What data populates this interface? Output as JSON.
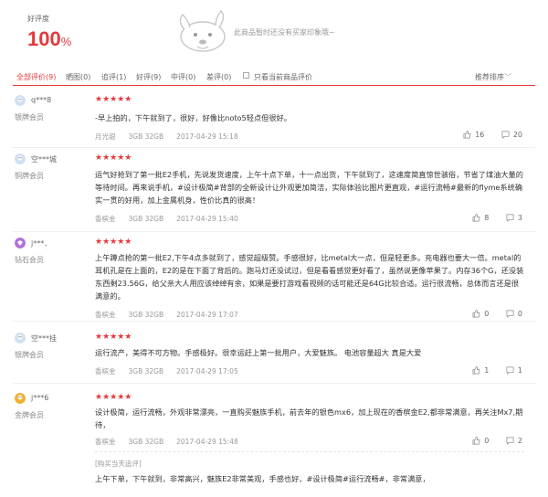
{
  "summary": {
    "rate_label": "好评度",
    "rate_number": "100",
    "rate_unit": "%",
    "no_impression": "此商品暂时还没有买家印象哦~",
    "mascot_icon": "dog-mascot-icon"
  },
  "tabs": [
    {
      "label": "全部评价(9)",
      "active": true
    },
    {
      "label": "晒图(0)"
    },
    {
      "label": "追评(1)"
    },
    {
      "label": "好评(9)"
    },
    {
      "label": "中评(0)"
    },
    {
      "label": "差评(0)"
    }
  ],
  "only_current": "只看当前商品评价",
  "sort_label": "推荐排序",
  "colors": {
    "accent": "#e4393c",
    "star": "#e4393c"
  },
  "reviews": [
    {
      "user": "q***8",
      "level": "银牌会员",
      "avatar_color": "#cfe0f2",
      "stars": "★★★★★",
      "content": "-早上拍的，下午就到了，很好，好像比noto5轻点但很好。",
      "color": "月光银",
      "spec": "3GB 32GB",
      "date": "2017-04-29 15:18",
      "likes": "16",
      "comments": "20"
    },
    {
      "user": "空***城",
      "level": "铜牌会员",
      "avatar_color": "#cfe0f2",
      "stars": "★★★★★",
      "content": "运气好抢到了第一批E2手机，先说发货速度，上午十点下单，十一点出货，下午就到了，这速度简直惊世骇俗，节省了煤油大量的等待时间。再来说手机，#设计极简#背部的全新设计让外观更加简洁，实际体验比图片更直观，#运行流畅#最新的flyme系统确实一贯的好用，加上金属机身，性价比真的很高！",
      "color": "香槟金",
      "spec": "3GB 32GB",
      "date": "2017-04-29 15:40",
      "likes": "8",
      "comments": "3"
    },
    {
      "user": "j***．",
      "level": "钻石会员",
      "avatar_color": "#b36fd8",
      "stars": "★★★★★",
      "content": "上午蹲点抢的第一批E2,下午4点多就到了，感觉超级赞。手感很好，比metal大一点，但是轻更多。充电器也要大一倍。metal的耳机孔是在上面的，E2的是在下面了背后的。跑马灯还没试过，但是看看感觉更好看了，虽然说更像苹果了。内存36个G，还没装东西剩23.56G，给父亲大人用应该绰绰有余，如果是要打游戏看视频的话可能还是64G比较合适。运行很流畅，总体而言还是很满意的。",
      "color": "香槟金",
      "spec": "3GB 32GB",
      "date": "2017-04-29 17:07",
      "likes": "0",
      "comments": "0"
    },
    {
      "user": "空***挂",
      "level": "银牌会员",
      "avatar_color": "#cfe0f2",
      "stars": "★★★★★",
      "content": "运行流产，美得不可方物。手感极好。很幸运赶上第一批用户，大爱魅族。 电池容量超大 真是大爱",
      "color": "香槟金",
      "spec": "3GB 32GB",
      "date": "2017-04-29 17:05",
      "likes": "1",
      "comments": "1"
    },
    {
      "user": "j***6",
      "level": "金牌会员",
      "avatar_color": "#f0b030",
      "stars": "★★★★★",
      "content": "设计极简，运行流畅，外观非常漂亮，一直购买魅族手机，前去年的银色mx6，加上现在的香槟金E2,都非常满意，再关注Mx7,期待，",
      "color": "香槟金",
      "spec": "3GB 32GB",
      "date": "2017-04-29 15:48",
      "likes": "0",
      "comments": "2",
      "followup_label": "[购买当天追评]",
      "followup": "上午下单，下午就到，非常高兴，魅族E2非常美观，手感也好，#设计极简#运行流畅#，非常满意，"
    }
  ]
}
